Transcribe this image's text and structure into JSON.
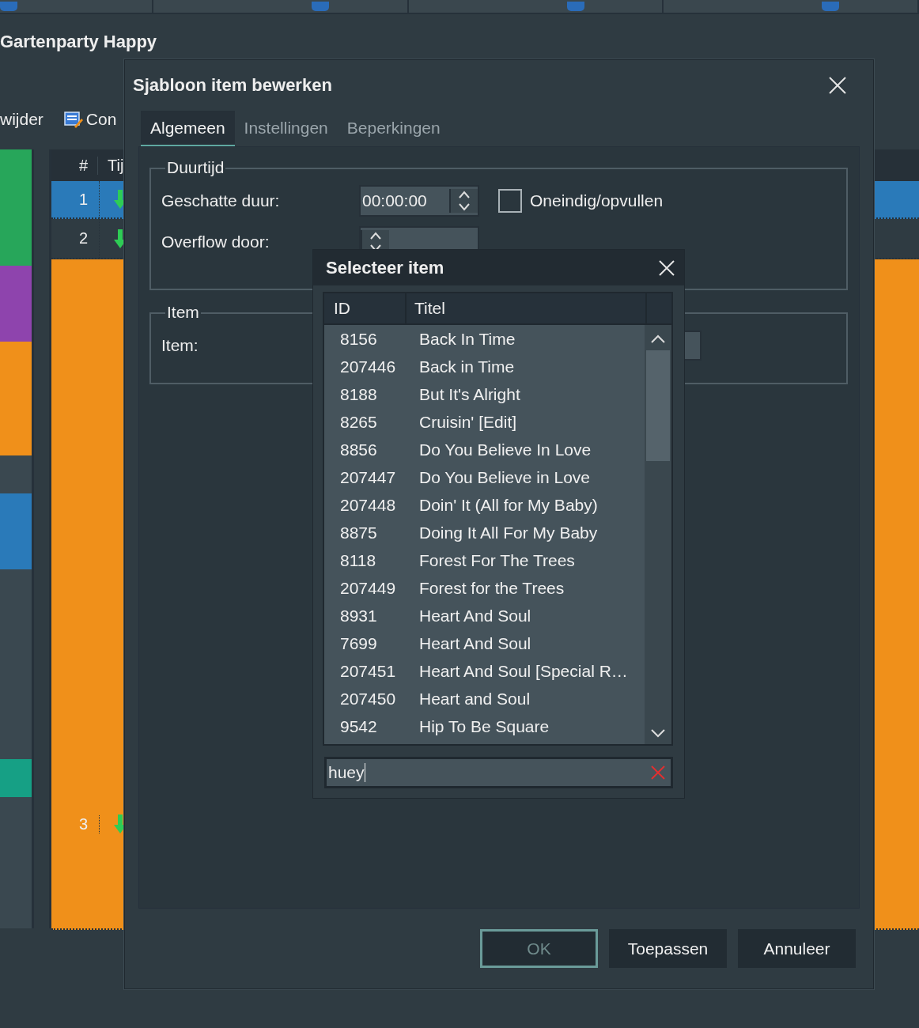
{
  "background": {
    "title": "Gartenparty Happy",
    "toolbar": [
      {
        "label": "wijder",
        "kind": "text"
      },
      {
        "label": "Con",
        "kind": "icon"
      }
    ],
    "color_strip": [
      {
        "color": "#27a65a"
      },
      {
        "color": "#8e44ad"
      },
      {
        "color": "#f0901a"
      },
      {
        "color": "#3a4850"
      },
      {
        "color": "#2a7ab9"
      },
      {
        "color": "#3a4850"
      },
      {
        "color": "#16a085"
      },
      {
        "color": "#3a4850"
      }
    ],
    "table": {
      "columns": [
        "#",
        "Tij"
      ],
      "rows": [
        {
          "number": "1",
          "selected": true
        },
        {
          "number": "2",
          "selected": false,
          "color": "#2f3b42"
        },
        {
          "number": "3",
          "selected": false,
          "color": "#f0901a"
        }
      ]
    }
  },
  "dialog": {
    "title": "Sjabloon item bewerken",
    "tabs": [
      {
        "label": "Algemeen",
        "selected": true
      },
      {
        "label": "Instellingen",
        "selected": false
      },
      {
        "label": "Beperkingen",
        "selected": false
      }
    ],
    "duration_group": {
      "title": "Duurtijd",
      "estimated_label": "Geschatte duur:",
      "estimated_value": "00:00:00",
      "endless_label": "Oneindig/opvullen",
      "endless_checked": false,
      "overflow_label": "Overflow door:"
    },
    "item_group": {
      "title": "Item",
      "item_label": "Item:"
    },
    "buttons": [
      {
        "label": "OK",
        "disabled": true
      },
      {
        "label": "Toepassen",
        "disabled": false
      },
      {
        "label": "Annuleer",
        "disabled": false
      }
    ]
  },
  "popup": {
    "title": "Selecteer item",
    "columns": [
      "ID",
      "Titel"
    ],
    "rows": [
      {
        "id": "8156",
        "title": "Back In Time"
      },
      {
        "id": "207446",
        "title": "Back in Time"
      },
      {
        "id": "8188",
        "title": "But It's Alright"
      },
      {
        "id": "8265",
        "title": "Cruisin' [Edit]"
      },
      {
        "id": "8856",
        "title": "Do You Believe In Love"
      },
      {
        "id": "207447",
        "title": "Do You Believe in Love"
      },
      {
        "id": "207448",
        "title": "Doin' It (All for My Baby)"
      },
      {
        "id": "8875",
        "title": "Doing It All For My Baby"
      },
      {
        "id": "8118",
        "title": "Forest For The Trees"
      },
      {
        "id": "207449",
        "title": "Forest for the Trees"
      },
      {
        "id": "8931",
        "title": "Heart And Soul"
      },
      {
        "id": "7699",
        "title": "Heart And Soul"
      },
      {
        "id": "207451",
        "title": "Heart And Soul [Special R…"
      },
      {
        "id": "207450",
        "title": "Heart and Soul"
      },
      {
        "id": "9542",
        "title": "Hip To Be Square"
      }
    ],
    "search_value": "huey"
  }
}
